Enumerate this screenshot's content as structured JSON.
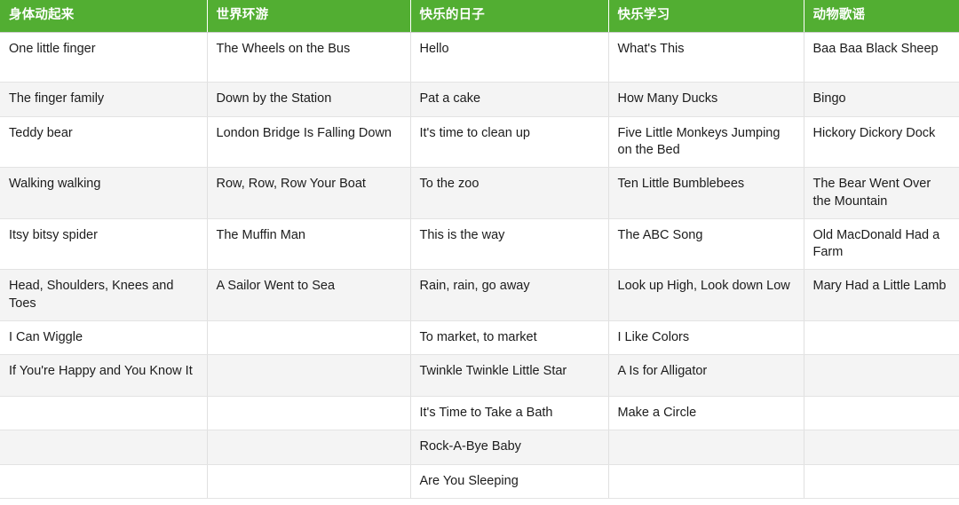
{
  "table": {
    "columns": [
      {
        "key": "body",
        "label": "身体动起来"
      },
      {
        "key": "world",
        "label": "世界环游"
      },
      {
        "key": "happy_days",
        "label": "快乐的日子"
      },
      {
        "key": "happy_learning",
        "label": "快乐学习"
      },
      {
        "key": "animal_songs",
        "label": "动物歌谣"
      }
    ],
    "header_background": "#52AE32",
    "header_text_color": "#ffffff",
    "stripe_color": "#f4f4f4",
    "border_color": "#e0e0e0",
    "rows": [
      {
        "height": "tall",
        "cells": [
          "One little finger",
          "The Wheels on the Bus",
          "Hello",
          "What's This",
          "Baa Baa Black Sheep"
        ]
      },
      {
        "height": "short",
        "cells": [
          "The finger family",
          "Down by the Station",
          "Pat a cake",
          "How Many Ducks",
          "Bingo"
        ]
      },
      {
        "height": "mid",
        "cells": [
          "Teddy bear",
          "London Bridge Is Falling Down",
          "It's time to clean up",
          "Five Little Monkeys Jumping on the Bed",
          "Hickory Dickory Dock"
        ]
      },
      {
        "height": "mid",
        "cells": [
          "Walking walking",
          "Row, Row, Row Your Boat",
          "To the zoo",
          "Ten Little Bumblebees",
          "The Bear Went Over the Mountain"
        ]
      },
      {
        "height": "mid",
        "cells": [
          "Itsy bitsy spider",
          "The Muffin Man",
          "This is the way",
          "The ABC Song",
          "Old MacDonald Had a Farm"
        ]
      },
      {
        "height": "mid",
        "cells": [
          "Head, Shoulders, Knees and Toes",
          "A Sailor Went to Sea",
          "Rain, rain, go away",
          "Look up High, Look down Low",
          "Mary Had a Little Lamb"
        ]
      },
      {
        "height": "short",
        "cells": [
          "I Can Wiggle",
          "",
          "To market, to market",
          "I Like Colors",
          ""
        ]
      },
      {
        "height": "mid",
        "cells": [
          "If You're Happy and You Know It",
          "",
          "Twinkle Twinkle Little Star",
          "A Is for Alligator",
          ""
        ]
      },
      {
        "height": "short",
        "cells": [
          "",
          "",
          "It's Time to Take a Bath",
          "Make a Circle",
          ""
        ]
      },
      {
        "height": "short",
        "cells": [
          "",
          "",
          "Rock-A-Bye Baby",
          "",
          ""
        ]
      },
      {
        "height": "short",
        "cells": [
          "",
          "",
          "Are You Sleeping",
          "",
          ""
        ]
      }
    ]
  }
}
